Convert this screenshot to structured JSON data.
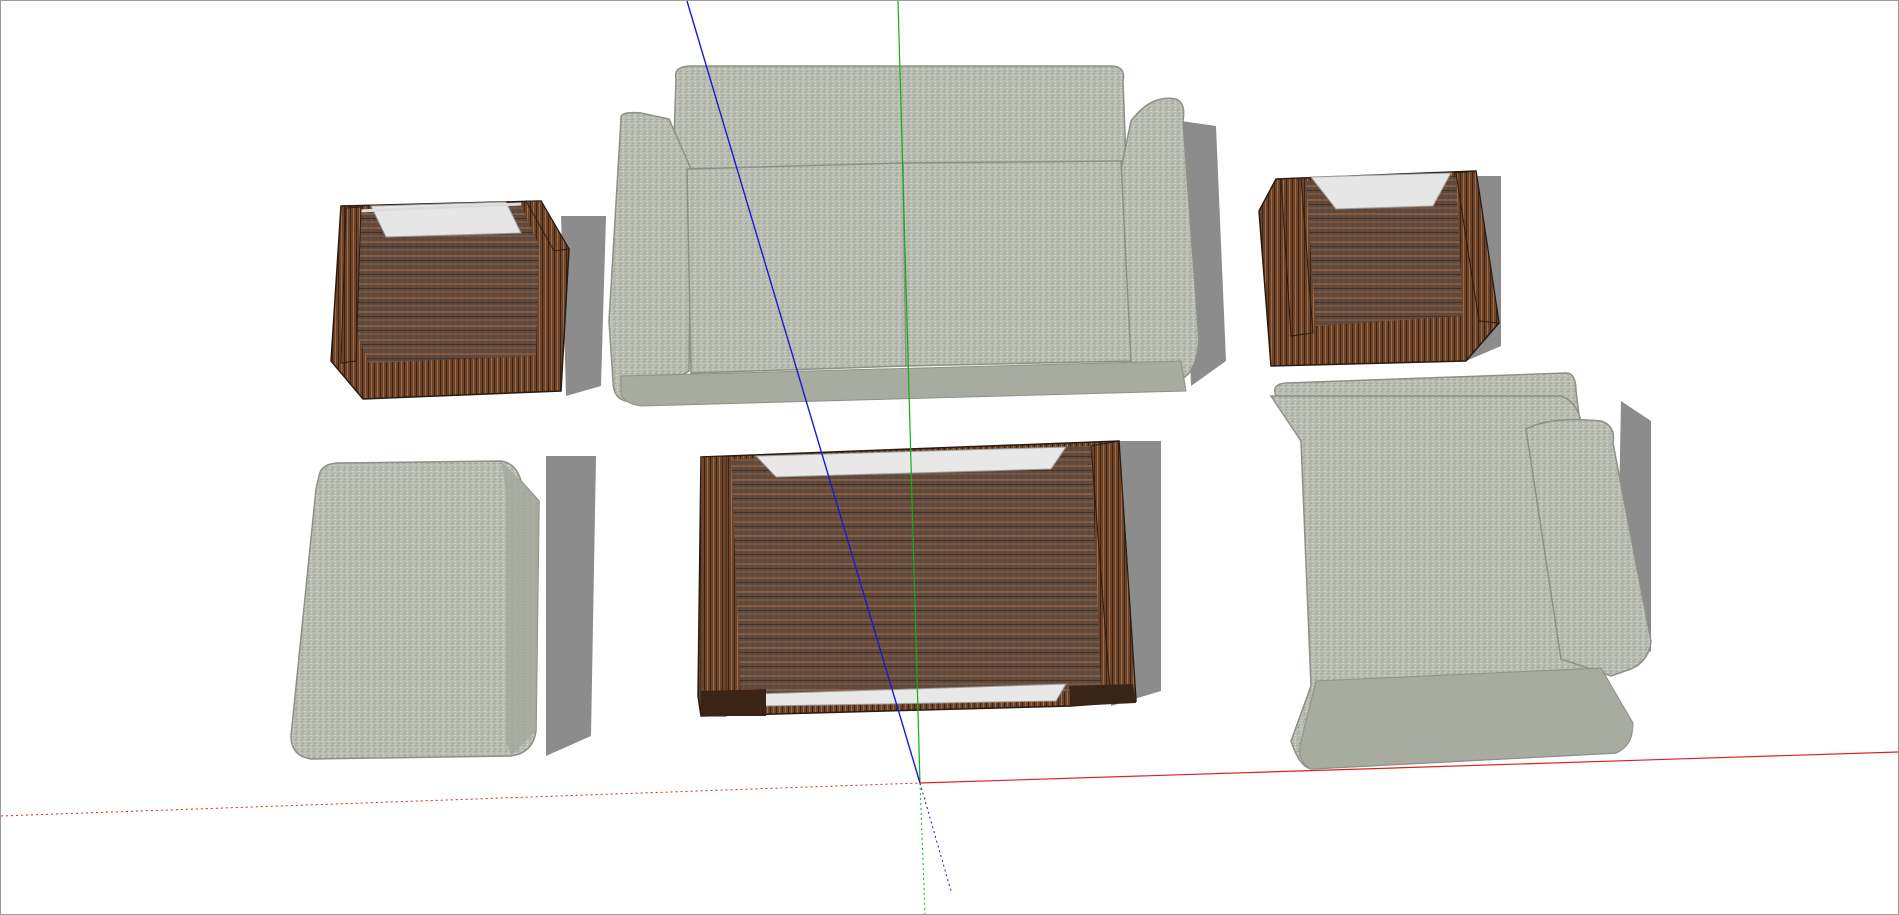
{
  "viewport": {
    "background": "#ffffff",
    "border_color": "#9a9a9a"
  },
  "axes": {
    "x_color": "#e02020",
    "y_color": "#10b010",
    "z_color": "#1a1ad0"
  },
  "materials": {
    "fabric_base": "#b9bcb1",
    "fabric_shade": "#9ea196",
    "fabric_light": "#cfd1c8",
    "wood_dark": "#3a2418",
    "wood_mid": "#6b4429",
    "wood_light": "#a06a44",
    "glass_tint": "#6e6a66",
    "glass_frame": "#d8d8d8",
    "shadow": "#8c8c8c"
  },
  "scene_objects": [
    {
      "icon": "sofa-icon",
      "name": "three-seat-sofa"
    },
    {
      "icon": "table-icon",
      "name": "left-side-table"
    },
    {
      "icon": "table-icon",
      "name": "right-side-table"
    },
    {
      "icon": "table-icon",
      "name": "coffee-table"
    },
    {
      "icon": "ottoman-icon",
      "name": "ottoman"
    },
    {
      "icon": "armchair-icon",
      "name": "armchair"
    }
  ]
}
